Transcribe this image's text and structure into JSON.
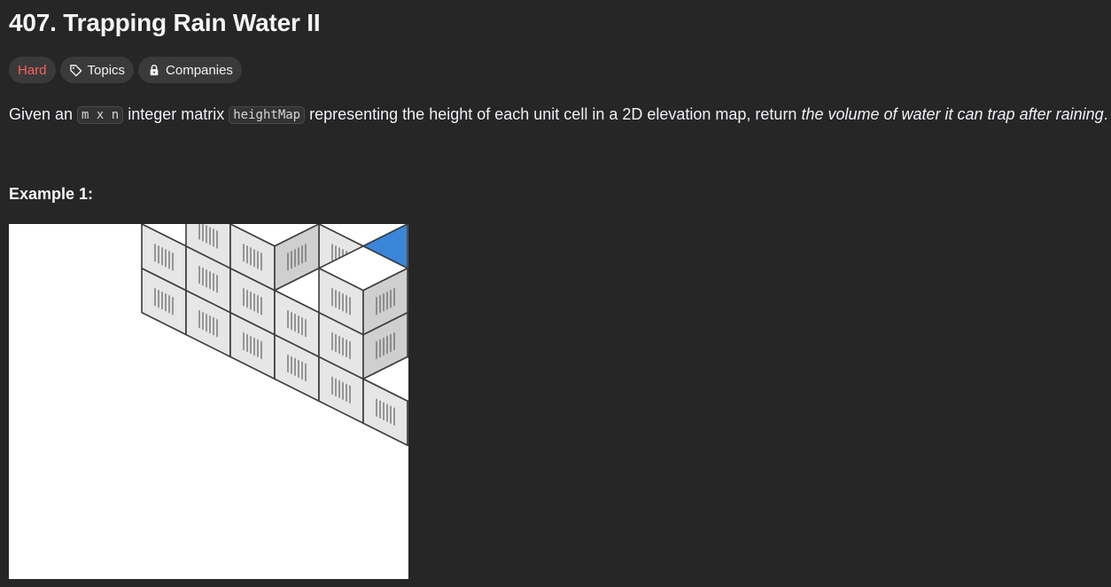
{
  "problem": {
    "title": "407. Trapping Rain Water II",
    "difficulty": "Hard",
    "topics_label": "Topics",
    "companies_label": "Companies"
  },
  "description": {
    "part1": "Given an ",
    "code1": "m x n",
    "part2": " integer matrix ",
    "code2": "heightMap",
    "part3": " representing the height of each unit cell in a 2D elevation map, return ",
    "emphasis": "the volume of water it can trap after raining",
    "part4": "."
  },
  "example": {
    "heading": "Example 1:"
  },
  "icons": {
    "topics": "tag-icon",
    "companies": "lock-icon"
  },
  "colors": {
    "background": "#262626",
    "hard": "#f8615c",
    "tag_bg": "#3a3a3a",
    "water": "#3a86d8"
  }
}
